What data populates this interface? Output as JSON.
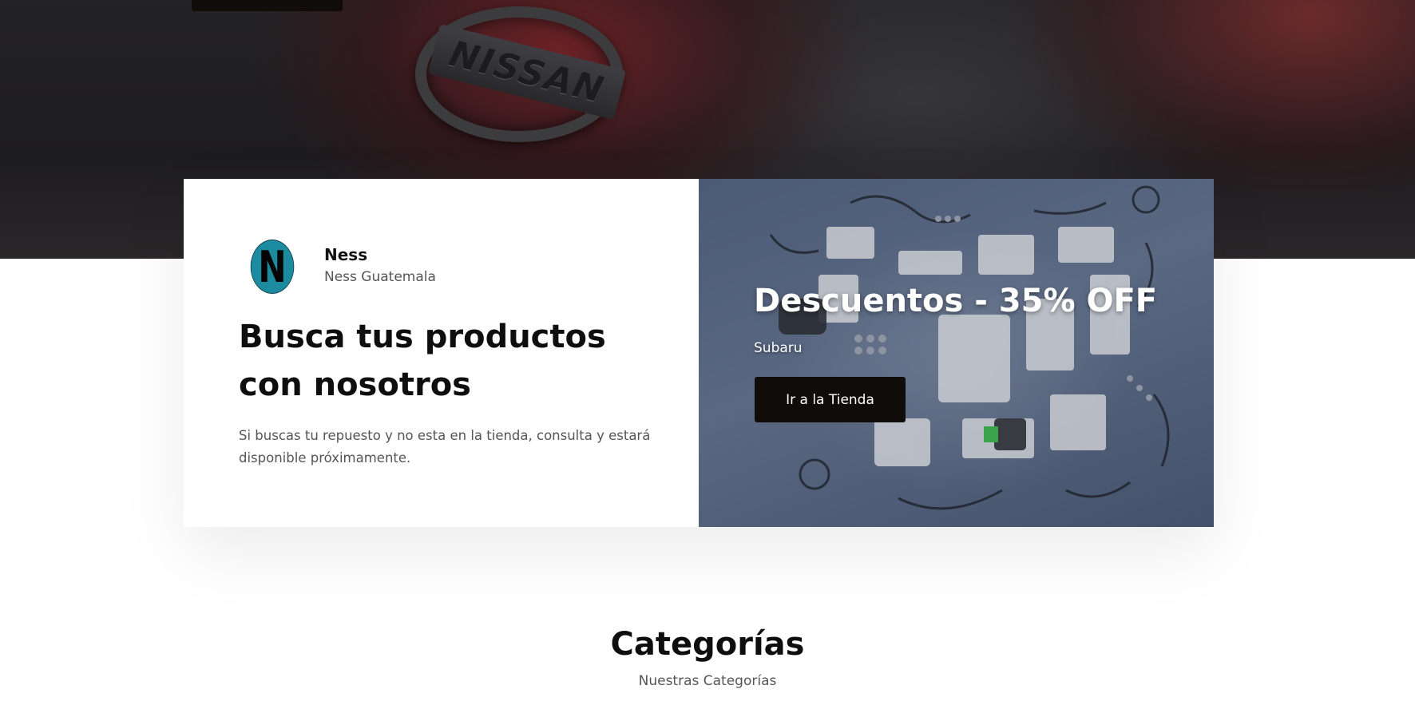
{
  "hero": {
    "background_image": "nissan-engine-cover",
    "logo_text": "NISSAN"
  },
  "brand": {
    "avatar_letter": "N",
    "avatar_color": "#1c8ba0",
    "name": "Ness",
    "subtitle": "Ness Guatemala"
  },
  "promo_left": {
    "title": "Busca tus productos con nosotros",
    "description": "Si buscas tu repuesto y no esta en la tienda, consulta y estará disponible próximamente."
  },
  "promo_right": {
    "background_image": "engine-parts-flatlay",
    "title": "Descuentos - 35% OFF",
    "subtitle": "Subaru",
    "button_label": "Ir a la Tienda",
    "button_color": "#0f0c0a"
  },
  "categories": {
    "title": "Categorías",
    "subtitle": "Nuestras Categorías"
  }
}
